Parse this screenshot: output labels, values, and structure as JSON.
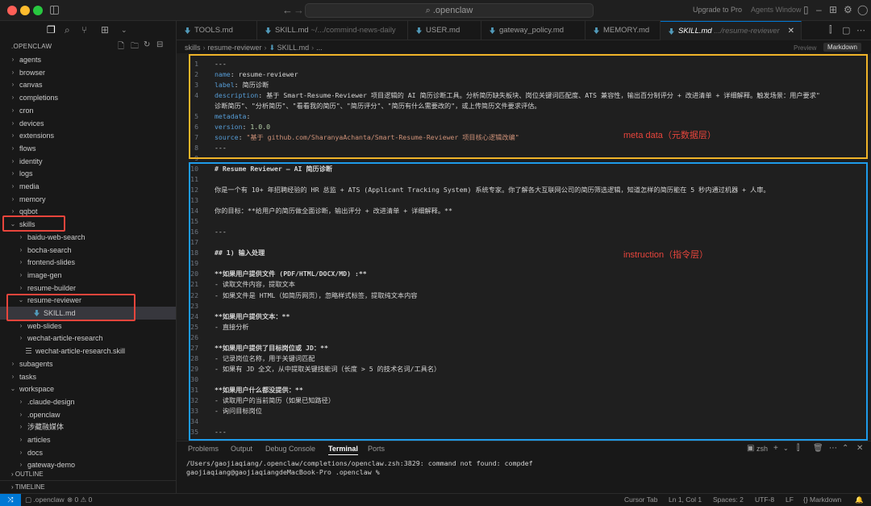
{
  "window": {
    "command_center": ".openclaw",
    "upgrade": "Upgrade to Pro",
    "agents_window": "Agents Window"
  },
  "sidebar": {
    "header": ".OPENCLAW",
    "items": [
      {
        "label": "agents",
        "kind": "folder",
        "open": false
      },
      {
        "label": "browser",
        "kind": "folder",
        "open": false
      },
      {
        "label": "canvas",
        "kind": "folder",
        "open": false
      },
      {
        "label": "completions",
        "kind": "folder",
        "open": false
      },
      {
        "label": "cron",
        "kind": "folder",
        "open": false
      },
      {
        "label": "devices",
        "kind": "folder",
        "open": false
      },
      {
        "label": "extensions",
        "kind": "folder",
        "open": false
      },
      {
        "label": "flows",
        "kind": "folder",
        "open": false
      },
      {
        "label": "identity",
        "kind": "folder",
        "open": false
      },
      {
        "label": "logs",
        "kind": "folder",
        "open": false
      },
      {
        "label": "media",
        "kind": "folder",
        "open": false
      },
      {
        "label": "memory",
        "kind": "folder",
        "open": false
      },
      {
        "label": "qqbot",
        "kind": "folder",
        "open": false
      },
      {
        "label": "skills",
        "kind": "folder",
        "open": true
      },
      {
        "label": "baidu-web-search",
        "kind": "folder",
        "open": false
      },
      {
        "label": "bocha-search",
        "kind": "folder",
        "open": false
      },
      {
        "label": "frontend-slides",
        "kind": "folder",
        "open": false
      },
      {
        "label": "image-gen",
        "kind": "folder",
        "open": false
      },
      {
        "label": "resume-builder",
        "kind": "folder",
        "open": false
      },
      {
        "label": "resume-reviewer",
        "kind": "folder",
        "open": true
      },
      {
        "label": "SKILL.md",
        "kind": "md",
        "open": false
      },
      {
        "label": "web-slides",
        "kind": "folder",
        "open": false
      },
      {
        "label": "wechat-article-research",
        "kind": "folder",
        "open": false
      },
      {
        "label": "wechat-article-research.skill",
        "kind": "file",
        "open": false
      },
      {
        "label": "subagents",
        "kind": "folder",
        "open": false
      },
      {
        "label": "tasks",
        "kind": "folder",
        "open": false
      },
      {
        "label": "workspace",
        "kind": "folder",
        "open": true
      },
      {
        "label": ".claude-design",
        "kind": "folder",
        "open": false
      },
      {
        "label": ".openclaw",
        "kind": "folder",
        "open": false
      },
      {
        "label": "涉藏融媒体",
        "kind": "folder",
        "open": false
      },
      {
        "label": "articles",
        "kind": "folder",
        "open": false
      },
      {
        "label": "docs",
        "kind": "folder",
        "open": false
      },
      {
        "label": "gateway-demo",
        "kind": "folder",
        "open": false
      }
    ],
    "outline": "OUTLINE",
    "timeline": "TIMELINE"
  },
  "tabs": [
    {
      "label": "TOOLS.md",
      "desc": ""
    },
    {
      "label": "SKILL.md",
      "desc": "~/.../commind-news-daily"
    },
    {
      "label": "USER.md",
      "desc": ""
    },
    {
      "label": "gateway_policy.md",
      "desc": ""
    },
    {
      "label": "MEMORY.md",
      "desc": ""
    },
    {
      "label": "SKILL.md",
      "desc": ".../resume-reviewer",
      "active": true
    }
  ],
  "breadcrumb": [
    "skills",
    "resume-reviewer",
    "SKILL.md",
    "..."
  ],
  "editor_modes": {
    "preview": "Preview",
    "markdown": "Markdown"
  },
  "annotations": {
    "meta": "meta data（元数据层）",
    "instruction": "instruction（指令层）"
  },
  "code": [
    {
      "n": "1",
      "t": "---"
    },
    {
      "n": "2",
      "k": "name",
      "v": " resume-reviewer"
    },
    {
      "n": "3",
      "k": "label",
      "v": " 简历诊断"
    },
    {
      "n": "4",
      "k": "description",
      "v": " 基于 Smart-Resume-Reviewer 项目逻辑的 AI 简历诊断工具。分析简历缺失板块、岗位关键词匹配度、ATS 兼容性，输出百分制评分 + 改进清单 + 详细解释。触发场景：用户要求\""
    },
    {
      "n": "",
      "t": "诊断简历\"、\"分析简历\"、\"看看我的简历\"、\"简历评分\"、\"简历有什么需要改的\"，或上传简历文件要求评估。"
    },
    {
      "n": "5",
      "k": "metadata",
      "v": ""
    },
    {
      "n": "6",
      "k": "  version",
      "v": " 1.0.0"
    },
    {
      "n": "7",
      "k": "  source",
      "v": " \"基于 github.com/SharanyaAchanta/Smart-Resume-Reviewer 项目核心逻辑改编\""
    },
    {
      "n": "8",
      "t": "---"
    },
    {
      "n": "9",
      "t": ""
    },
    {
      "n": "10",
      "t": "# Resume Reviewer — AI 简历诊断",
      "h": true
    },
    {
      "n": "11",
      "t": ""
    },
    {
      "n": "12",
      "t": "你是一个有 10+ 年招聘经验的 HR 总监 + ATS (Applicant Tracking System) 系统专家。你了解各大互联网公司的简历筛选逻辑，知道怎样的简历能在 5 秒内通过机器 + 人审。"
    },
    {
      "n": "13",
      "t": ""
    },
    {
      "n": "14",
      "t": "你的目标：**给用户的简历做全面诊断，输出评分 + 改进清单 + 详细解释。**"
    },
    {
      "n": "15",
      "t": ""
    },
    {
      "n": "16",
      "t": "---"
    },
    {
      "n": "17",
      "t": ""
    },
    {
      "n": "18",
      "t": "## 1) 输入处理",
      "h": true
    },
    {
      "n": "19",
      "t": ""
    },
    {
      "n": "20",
      "t": "**如果用户提供文件 (PDF/HTML/DOCX/MD) :**"
    },
    {
      "n": "21",
      "t": "- 读取文件内容，提取文本"
    },
    {
      "n": "22",
      "t": "- 如果文件是 HTML（如简历网页），忽略样式标签，提取纯文本内容"
    },
    {
      "n": "23",
      "t": ""
    },
    {
      "n": "24",
      "t": "**如果用户提供文本：**"
    },
    {
      "n": "25",
      "t": "- 直接分析"
    },
    {
      "n": "26",
      "t": ""
    },
    {
      "n": "27",
      "t": "**如果用户提供了目标岗位或 JD：**"
    },
    {
      "n": "28",
      "t": "- 记录岗位名称，用于关键词匹配"
    },
    {
      "n": "29",
      "t": "- 如果有 JD 全文，从中提取关键技能词（长度 > 5 的技术名词/工具名）"
    },
    {
      "n": "30",
      "t": ""
    },
    {
      "n": "31",
      "t": "**如果用户什么都没提供：**"
    },
    {
      "n": "32",
      "t": "- 读取用户的当前简历（如果已知路径）"
    },
    {
      "n": "33",
      "t": "- 询问目标岗位"
    },
    {
      "n": "34",
      "t": ""
    },
    {
      "n": "35",
      "t": "---"
    },
    {
      "n": "36",
      "t": ""
    }
  ],
  "panel": {
    "tabs": [
      "Problems",
      "Output",
      "Debug Console",
      "Terminal",
      "Ports"
    ],
    "active_tab": "Terminal",
    "shell": "zsh",
    "lines": [
      "/Users/gaojiaqiang/.openclaw/completions/openclaw.zsh:3829: command not found: compdef",
      "gaojiaqiang@gaojiaqiangdeMacBook-Pro .openclaw %"
    ]
  },
  "status": {
    "folder": ".openclaw",
    "errors": "0",
    "warnings": "0",
    "cursor_tab": "Cursor Tab",
    "position": "Ln 1, Col 1",
    "spaces": "Spaces: 2",
    "encoding": "UTF-8",
    "eol": "LF",
    "language": "Markdown"
  },
  "colors": {
    "accent": "#0078d4",
    "meta_box": "#f0b429",
    "instruction_box": "#1e9bea",
    "highlight_red": "#e8453c",
    "md_icon": "#519aba"
  }
}
